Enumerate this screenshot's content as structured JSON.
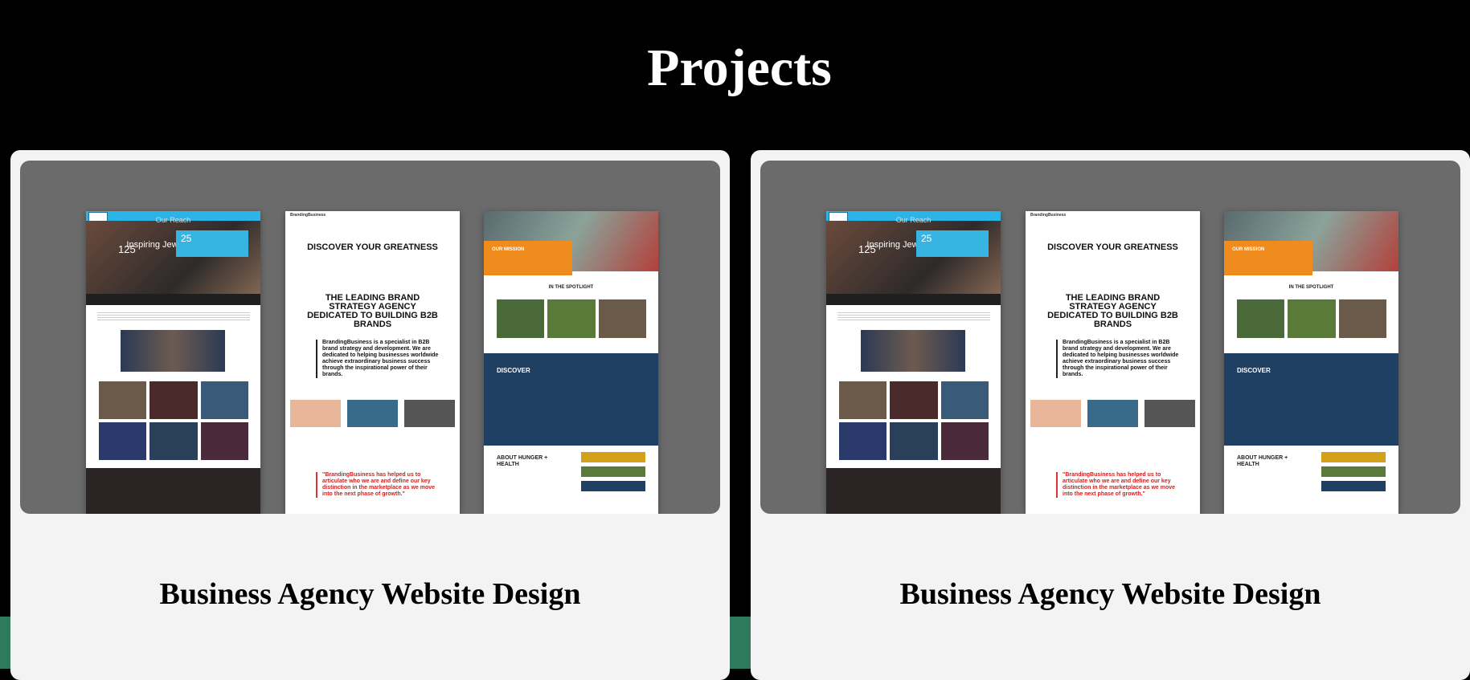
{
  "page": {
    "title": "Projects"
  },
  "projects": [
    {
      "title": "Business Agency Website Design",
      "mockups": {
        "left": {
          "hero_text": "Inspiring Jewish Homes",
          "section_title": "Our Reach",
          "stat_a": "125",
          "stat_b": "25"
        },
        "center": {
          "logo": "BrandingBusiness",
          "headline": "DISCOVER YOUR GREATNESS",
          "subheadline": "THE LEADING BRAND STRATEGY AGENCY DEDICATED TO BUILDING B2B BRANDS",
          "body": "BrandingBusiness is a specialist in B2B brand strategy and development. We are dedicated to helping businesses worldwide achieve extraordinary business success through the inspirational power of their brands.",
          "quote": "\"BrandingBusiness has helped us to articulate who we are and define our key distinction in the marketplace as we move into the next phase of growth.\""
        },
        "right": {
          "mission": "OUR MISSION",
          "spotlight": "IN THE SPOTLIGHT",
          "discover": "DISCOVER",
          "about": "ABOUT HUNGER + HEALTH"
        }
      }
    },
    {
      "title": "Business Agency Website Design",
      "mockups": {
        "left": {
          "hero_text": "Inspiring Jewish Homes",
          "section_title": "Our Reach",
          "stat_a": "125",
          "stat_b": "25"
        },
        "center": {
          "logo": "BrandingBusiness",
          "headline": "DISCOVER YOUR GREATNESS",
          "subheadline": "THE LEADING BRAND STRATEGY AGENCY DEDICATED TO BUILDING B2B BRANDS",
          "body": "BrandingBusiness is a specialist in B2B brand strategy and development. We are dedicated to helping businesses worldwide achieve extraordinary business success through the inspirational power of their brands.",
          "quote": "\"BrandingBusiness has helped us to articulate who we are and define our key distinction in the marketplace as we move into the next phase of growth.\""
        },
        "right": {
          "mission": "OUR MISSION",
          "spotlight": "IN THE SPOTLIGHT",
          "discover": "DISCOVER",
          "about": "ABOUT HUNGER + HEALTH"
        }
      }
    }
  ]
}
